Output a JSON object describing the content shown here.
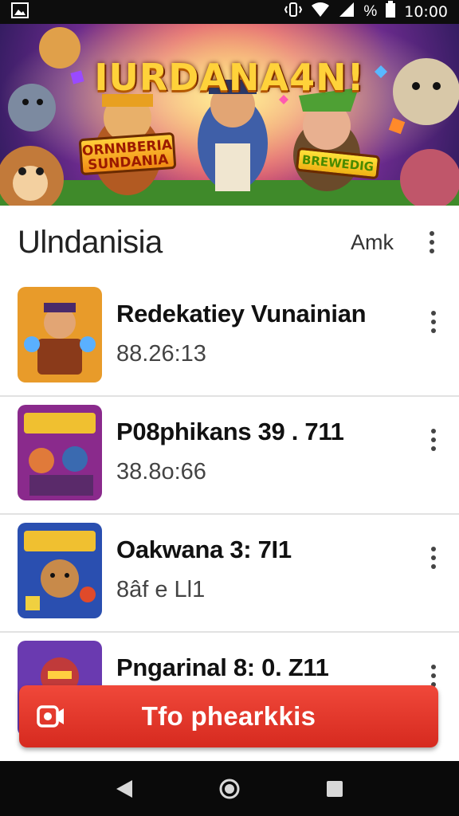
{
  "status_bar": {
    "time": "10:00",
    "icons": [
      "image-notification-icon",
      "vibrate-icon",
      "wifi-icon",
      "signal-icon",
      "battery-icon"
    ],
    "signal_label": "%"
  },
  "banner": {
    "title": "IURDANA4N!",
    "sign_left": "ORNNBERIA SUNDANIA",
    "sign_right": "BREWEDIG"
  },
  "header": {
    "title": "Ulndanisia",
    "action_label": "Amk"
  },
  "list": [
    {
      "title": "Redekatiey Vunainian",
      "subtitle": "88.26:13",
      "thumb": "hero-knight",
      "accent": "#e89b2a"
    },
    {
      "title": "P08phikans 39 . 711",
      "subtitle": "38.8o:66",
      "thumb": "squad-battle",
      "accent": "#8a2a8c"
    },
    {
      "title": "Oakwana 3: 7I1",
      "subtitle": "8âf e Ll1",
      "thumb": "bear-warrior",
      "accent": "#2a4fb0"
    },
    {
      "title": "Pngarinal 8: 0. Z11",
      "subtitle": "",
      "thumb": "robot-brawler",
      "accent": "#6a3ab0"
    }
  ],
  "cta": {
    "label": "Tfo phearkkis",
    "icon": "video-record-icon",
    "color": "#e3362a"
  },
  "navbar": {
    "buttons": [
      "back-icon",
      "home-icon",
      "recents-icon"
    ]
  }
}
